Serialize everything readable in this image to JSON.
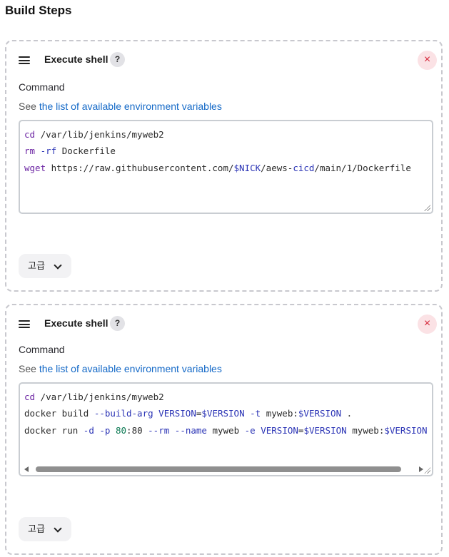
{
  "section": {
    "title": "Build Steps"
  },
  "steps": [
    {
      "title": "Execute shell",
      "help": "?",
      "close": "×",
      "command_label": "Command",
      "env_prefix": "See",
      "env_link": "the list of available environment variables",
      "advanced_label": "고급",
      "command_lines": [
        "cd /var/lib/jenkins/myweb2",
        "rm -rf Dockerfile",
        "wget https://raw.githubusercontent.com/$NICK/aews-cicd/main/1/Dockerfile"
      ]
    },
    {
      "title": "Execute shell",
      "help": "?",
      "close": "×",
      "command_label": "Command",
      "env_prefix": "See",
      "env_link": "the list of available environment variables",
      "advanced_label": "고급",
      "command_lines": [
        "cd /var/lib/jenkins/myweb2",
        "docker build --build-arg VERSION=$VERSION -t myweb:$VERSION .",
        "docker run -d -p 80:80 --rm --name myweb -e VERSION=$VERSION myweb:$VERSION"
      ]
    }
  ],
  "icons": {
    "drag": "drag-handle-icon",
    "help": "help-icon",
    "close": "close-icon",
    "chevron": "chevron-down-icon"
  },
  "colors": {
    "link": "#1469c7",
    "close_bg": "#fbe2e5",
    "close_fg": "#d6293c",
    "dashed_border": "#c8c8ce"
  }
}
